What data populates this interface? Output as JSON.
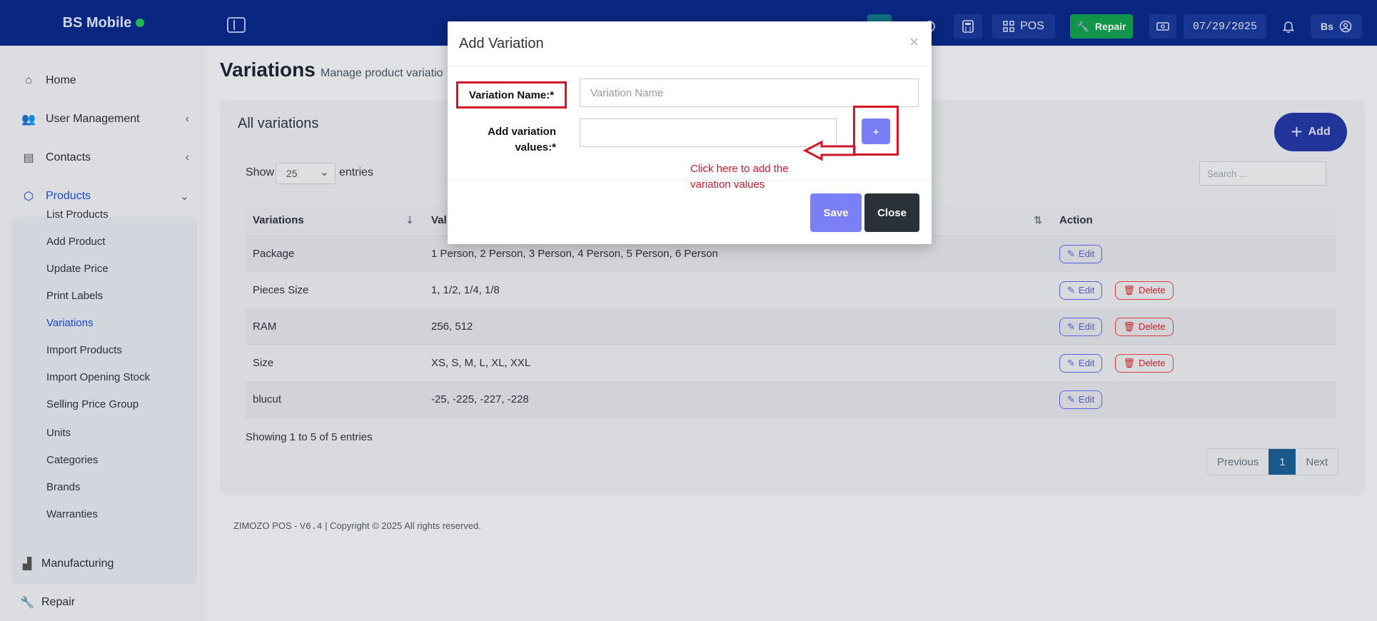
{
  "app": {
    "brand": "BS Mobile",
    "topbar": {
      "pos_label": "POS",
      "repair_label": "Repair",
      "date": "07/29/2025",
      "user_initials": "Bs"
    }
  },
  "sidebar": {
    "home": "Home",
    "user_management": "User Management",
    "contacts": "Contacts",
    "products": "Products",
    "product_items": [
      "List Products",
      "Add Product",
      "Update Price",
      "Print Labels",
      "Variations",
      "Import Products",
      "Import Opening Stock",
      "Selling Price Group",
      "Units",
      "Categories",
      "Brands",
      "Warranties"
    ],
    "manufacturing": "Manufacturing",
    "repair": "Repair"
  },
  "page": {
    "title": "Variations",
    "subtitle": "Manage product variatio",
    "card_title": "All variations",
    "add_label": "Add",
    "show_label": "Show",
    "page_size": "25",
    "entries_label": "entries",
    "search_placeholder": "Search ...",
    "columns": [
      "Variations",
      "Val",
      "Action"
    ],
    "rows": [
      {
        "name": "Package",
        "values": "1 Person, 2 Person, 3 Person, 4 Person, 5 Person, 6 Person"
      },
      {
        "name": "Pieces Size",
        "values": "1, 1/2, 1/4, 1/8"
      },
      {
        "name": "RAM",
        "values": "256, 512"
      },
      {
        "name": "Size",
        "values": "XS, S, M, L, XL, XXL"
      },
      {
        "name": "blucut",
        "values": "-25, -225, -227, -228"
      }
    ],
    "edit_label": "Edit",
    "delete_label": "Delete",
    "showing_text": "Showing 1 to 5 of 5 entries",
    "pager": {
      "previous": "Previous",
      "current": "1",
      "next": "Next"
    },
    "footer_prefix": "ZIMOZO POS - ",
    "footer_version": "V6.4",
    "footer_suffix": " | Copyright © 2025 All rights reserved."
  },
  "modal": {
    "title": "Add Variation",
    "close_glyph": "×",
    "name_label": "Variation Name:*",
    "name_placeholder": "Variation Name",
    "values_label_1": "Add variation",
    "values_label_2": "values:*",
    "plus_label": "+",
    "annotation": "Click here to add the variation values",
    "save_label": "Save",
    "close_label": "Close"
  },
  "colors": {
    "topbar": "#0a2a8a",
    "accent": "#7b7ff5",
    "annotation": "#d0172c",
    "active_nav": "#1d4ed8"
  }
}
